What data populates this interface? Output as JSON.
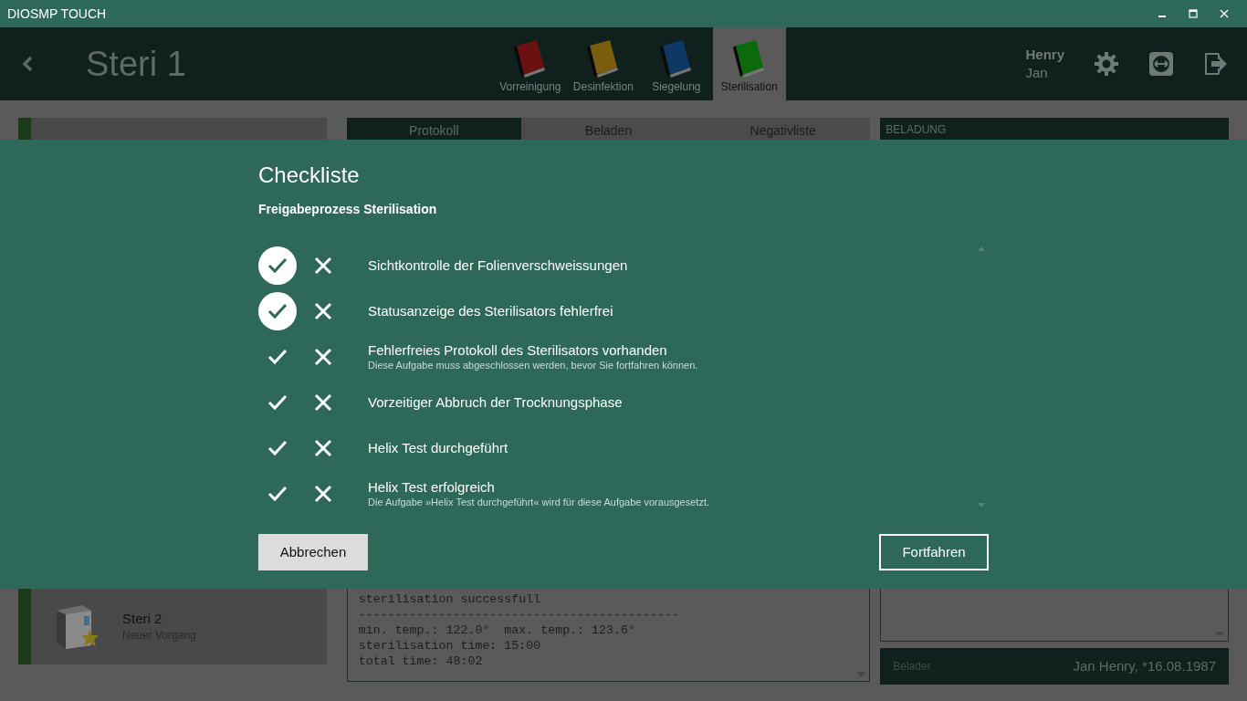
{
  "window": {
    "title": "DIOSMP TOUCH"
  },
  "header": {
    "title": "Steri 1",
    "user": {
      "last_name": "Henry",
      "first_name": "Jan"
    }
  },
  "process_tabs": [
    {
      "label": "Vorreinigung",
      "color": "#6a1212",
      "selected": false
    },
    {
      "label": "Desinfektion",
      "color": "#7a5e0e",
      "selected": false
    },
    {
      "label": "Siegelung",
      "color": "#0f3866",
      "selected": false
    },
    {
      "label": "Sterilisation",
      "color": "#0c6a0c",
      "selected": true
    }
  ],
  "left_panel": {
    "items": [
      {
        "title": "Steri 2",
        "subtitle": "Neuer Vorgang"
      }
    ]
  },
  "middle_panel": {
    "tabs": [
      {
        "label": "Protokoll",
        "selected": true
      },
      {
        "label": "Beladen",
        "selected": false
      },
      {
        "label": "Negativliste",
        "selected": false
      }
    ],
    "protocol_lines": [
      "sterilisation successfull",
      "--------------------------------------------",
      "min. temp.: 122.0°  max. temp.: 123.6°",
      "sterilisation time: 15:00",
      "total time: 48:02"
    ]
  },
  "right_panel": {
    "heading": "BELADUNG",
    "belader_label": "Belader",
    "belader_value": "Jan Henry, *16.08.1987"
  },
  "dialog": {
    "title": "Checkliste",
    "subtitle": "Freigabeprozess Sterilisation",
    "items": [
      {
        "text": "Sichtkontrolle der Folienverschweissungen",
        "confirmed": true
      },
      {
        "text": "Statusanzeige des Sterilisators fehlerfrei",
        "confirmed": true
      },
      {
        "text": "Fehlerfreies Protokoll des Sterilisators vorhanden",
        "note": "Diese Aufgabe muss abgeschlossen werden, bevor Sie fortfahren können.",
        "confirmed": false
      },
      {
        "text": "Vorzeitiger Abbruch der Trocknungsphase",
        "confirmed": false
      },
      {
        "text": "Helix Test durchgeführt",
        "confirmed": false
      },
      {
        "text": "Helix Test erfolgreich",
        "note": "Die Aufgabe »Helix Test durchgeführt« wird für diese Aufgabe vorausgesetzt.",
        "confirmed": false
      }
    ],
    "buttons": [
      {
        "label": "Abbrechen",
        "kind": "secondary"
      },
      {
        "label": "Fortfahren",
        "kind": "primary"
      }
    ]
  }
}
